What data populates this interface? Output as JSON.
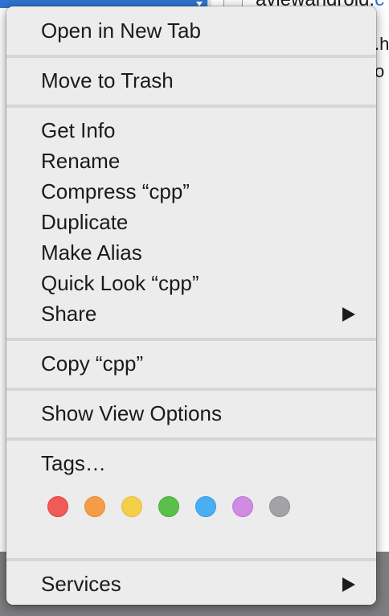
{
  "background": {
    "file_text_prefix": "aviewandroid.",
    "file_text_highlight": "c",
    "line_2": ".h",
    "line_3": "o"
  },
  "menu": {
    "items": [
      {
        "label": "Open in New Tab"
      },
      {
        "label": "Move to Trash"
      },
      {
        "label": "Get Info"
      },
      {
        "label": "Rename"
      },
      {
        "label": "Compress “cpp”"
      },
      {
        "label": "Duplicate"
      },
      {
        "label": "Make Alias"
      },
      {
        "label": "Quick Look “cpp”"
      },
      {
        "label": "Share",
        "submenu_icon": "triangle-right-icon"
      },
      {
        "label": "Copy “cpp”"
      },
      {
        "label": "Show View Options"
      },
      {
        "label": "Tags…"
      },
      {
        "label": "Services",
        "submenu_icon": "triangle-right-icon"
      }
    ],
    "tag_colors": [
      {
        "name": "red",
        "fill": "#f05a57",
        "border": "#e0403d"
      },
      {
        "name": "orange",
        "fill": "#f49c47",
        "border": "#e68a2f"
      },
      {
        "name": "yellow",
        "fill": "#f5cf4a",
        "border": "#e5bd33"
      },
      {
        "name": "green",
        "fill": "#5bc04b",
        "border": "#47ad38"
      },
      {
        "name": "blue",
        "fill": "#4aaff2",
        "border": "#329ce3"
      },
      {
        "name": "purple",
        "fill": "#d08be3",
        "border": "#bf76d4"
      },
      {
        "name": "gray",
        "fill": "#a3a3a6",
        "border": "#8f8f93"
      }
    ]
  }
}
